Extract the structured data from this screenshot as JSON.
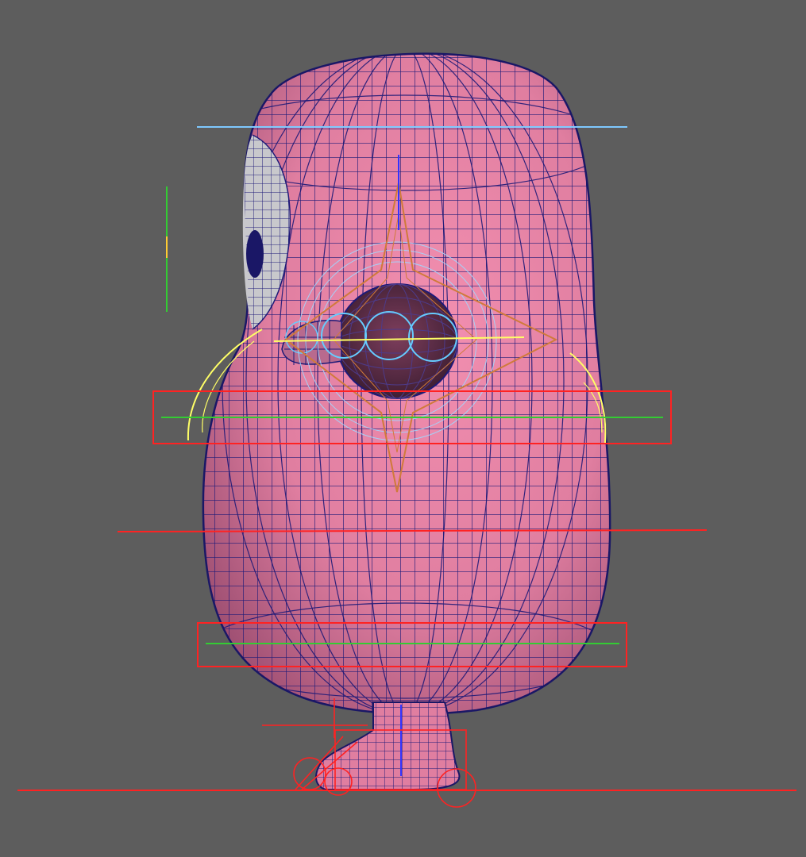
{
  "viewport": {
    "background": "#5d5d5d",
    "display_mode": "wireframe-on-shaded"
  },
  "model": {
    "surface_color": "#e07ea0",
    "wire_color": "#1e1a78",
    "eye_color": "#c8c8cc"
  },
  "controls": {
    "fk_control_color": "#ff2222",
    "curve_color": "#ffff66",
    "joint_color": "#66ccff",
    "axis_x_color": "#ff2222",
    "axis_y_color": "#33cc33",
    "axis_z_color": "#3333ff"
  }
}
